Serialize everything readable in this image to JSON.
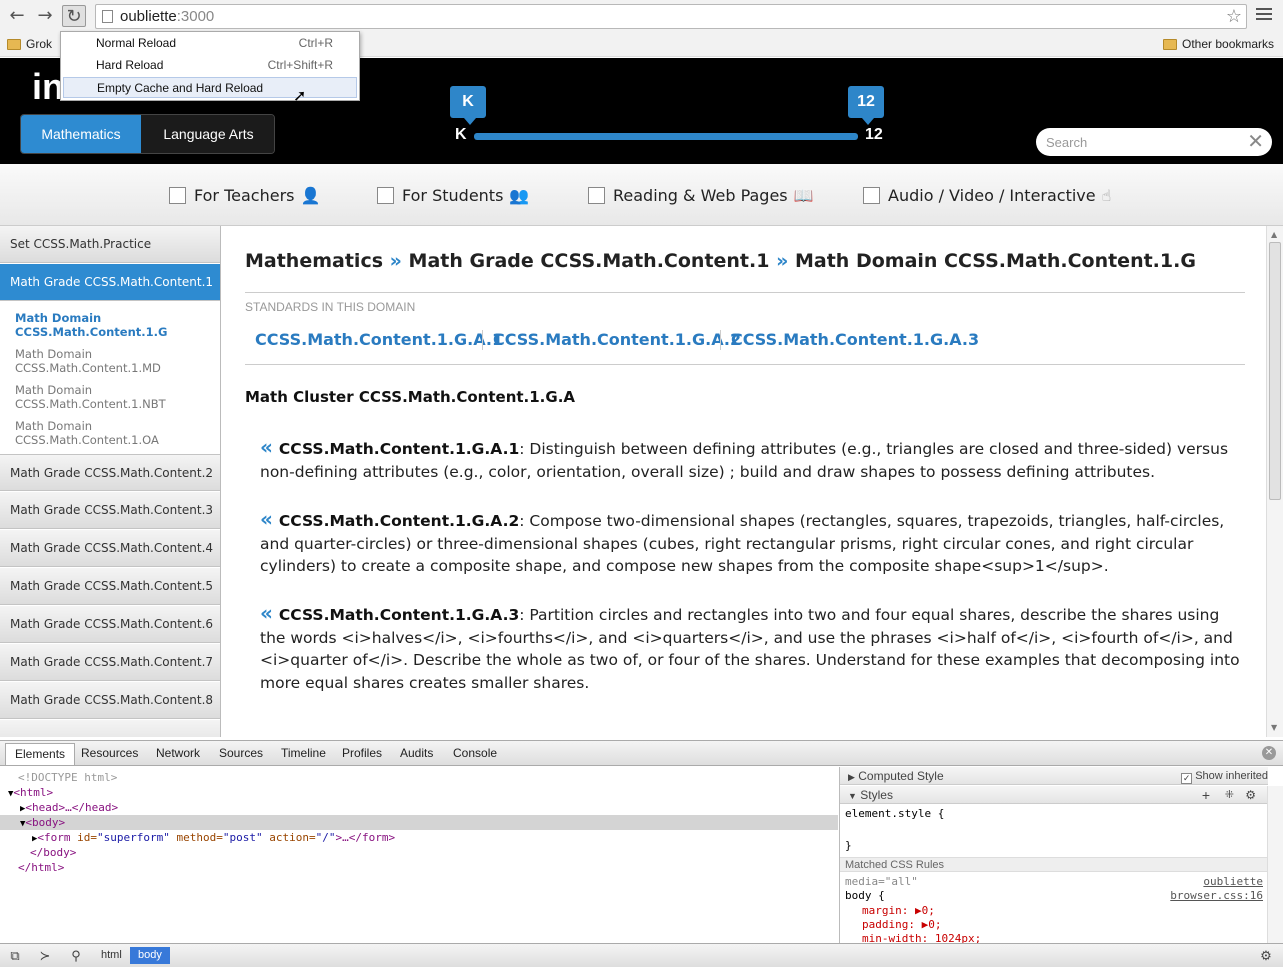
{
  "browser": {
    "url_host": "oubliette",
    "url_port": ":3000",
    "bookmarks": {
      "left": "Grok",
      "right": "Other bookmarks"
    },
    "reload_menu": [
      {
        "label": "Normal Reload",
        "shortcut": "Ctrl+R"
      },
      {
        "label": "Hard Reload",
        "shortcut": "Ctrl+Shift+R"
      },
      {
        "label": "Empty Cache and Hard Reload",
        "shortcut": ""
      }
    ]
  },
  "header": {
    "logo": "in",
    "subject_tabs": [
      {
        "label": "Mathematics",
        "active": true
      },
      {
        "label": "Language Arts",
        "active": false
      }
    ],
    "grade_range": {
      "min_label": "K",
      "max_label": "12",
      "min_flag": "K",
      "max_flag": "12"
    },
    "search": {
      "placeholder": "Search",
      "value": ""
    }
  },
  "filters": [
    {
      "label": "For Teachers",
      "icon": "teacher-icon",
      "checked": false
    },
    {
      "label": "For Students",
      "icon": "students-icon",
      "checked": false
    },
    {
      "label": "Reading & Web Pages",
      "icon": "book-icon",
      "checked": false
    },
    {
      "label": "Audio / Video / Interactive",
      "icon": "hand-pointer-icon",
      "checked": false
    }
  ],
  "sidebar": {
    "top_item": "Set CCSS.Math.Practice",
    "active_item": "Math Grade CCSS.Math.Content.1",
    "sub_items": [
      {
        "line1": "Math Domain",
        "line2": "CCSS.Math.Content.1.G",
        "current": true
      },
      {
        "line1": "Math Domain",
        "line2": "CCSS.Math.Content.1.MD",
        "current": false
      },
      {
        "line1": "Math Domain",
        "line2": "CCSS.Math.Content.1.NBT",
        "current": false
      },
      {
        "line1": "Math Domain",
        "line2": "CCSS.Math.Content.1.OA",
        "current": false
      }
    ],
    "grades": [
      "Math Grade CCSS.Math.Content.2",
      "Math Grade CCSS.Math.Content.3",
      "Math Grade CCSS.Math.Content.4",
      "Math Grade CCSS.Math.Content.5",
      "Math Grade CCSS.Math.Content.6",
      "Math Grade CCSS.Math.Content.7",
      "Math Grade CCSS.Math.Content.8"
    ]
  },
  "main": {
    "breadcrumb": [
      "Mathematics",
      "Math Grade CCSS.Math.Content.1",
      "Math Domain CCSS.Math.Content.1.G"
    ],
    "breadcrumb_sep": "»",
    "standards_heading": "STANDARDS IN THIS DOMAIN",
    "standard_links": [
      "CCSS.Math.Content.1.G.A.1",
      "CCSS.Math.Content.1.G.A.2",
      "CCSS.Math.Content.1.G.A.3"
    ],
    "cluster_title": "Math Cluster CCSS.Math.Content.1.G.A",
    "quote_mark": "«",
    "standards": [
      {
        "code": "CCSS.Math.Content.1.G.A.1",
        "text": ": Distinguish between defining attributes (e.g., triangles are closed and three-sided) versus non-defining attributes (e.g., color, orientation, overall size) ; build and draw shapes to possess defining attributes."
      },
      {
        "code": "CCSS.Math.Content.1.G.A.2",
        "text": ": Compose two-dimensional shapes (rectangles, squares, trapezoids, triangles, half-circles, and quarter-circles) or three-dimensional shapes (cubes, right rectangular prisms, right circular cones, and right circular cylinders) to create a composite shape, and compose new shapes from the composite shape<sup>1</sup>."
      },
      {
        "code": "CCSS.Math.Content.1.G.A.3",
        "text": ": Partition circles and rectangles into two and four equal shares, describe the shares using the words <i>halves</i>, <i>fourths</i>, and <i>quarters</i>, and use the phrases <i>half of</i>, <i>fourth of</i>, and <i>quarter of</i>. Describe the whole as two of, or four of the shares. Understand for these examples that decomposing into more equal shares creates smaller shares."
      }
    ]
  },
  "devtools": {
    "tabs": [
      "Elements",
      "Resources",
      "Network",
      "Sources",
      "Timeline",
      "Profiles",
      "Audits",
      "Console"
    ],
    "dom": {
      "doctype": "<!DOCTYPE html>",
      "html_open": "<html>",
      "head": "<head>…</head>",
      "body_open": "<body>",
      "form_open": "<form",
      "form_id_attr": "id=",
      "form_id_val": "\"superform\"",
      "form_method_attr": "method=",
      "form_method_val": "\"post\"",
      "form_action_attr": "action=",
      "form_action_val": "\"/\"",
      "form_close": ">…</form>",
      "body_close": "</body>",
      "html_close": "</html>"
    },
    "styles": {
      "computed_style": "Computed Style",
      "show_inherited": "Show inherited",
      "styles_label": "Styles",
      "element_style": "element.style {",
      "close_brace": "}",
      "matched_rules": "Matched CSS Rules",
      "media": "media=\"all\"",
      "source1": "oubliette",
      "selector": "body {",
      "source2": "browser.css:16",
      "props": [
        "margin: ▶0;",
        "padding: ▶0;",
        "min-width: 1024px;"
      ]
    },
    "breadcrumbs": [
      "html",
      "body"
    ]
  }
}
